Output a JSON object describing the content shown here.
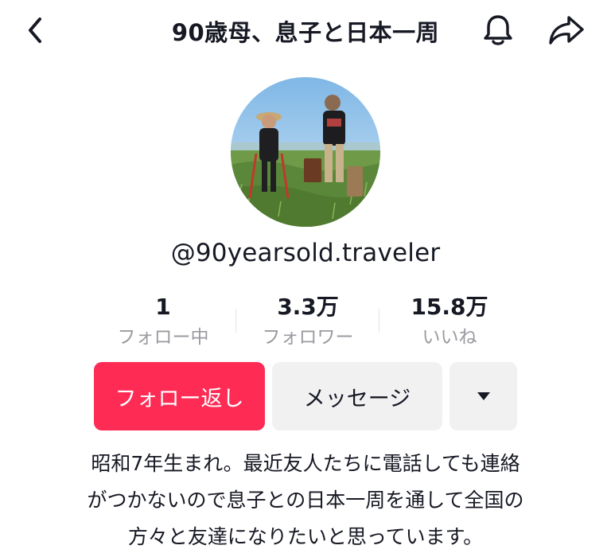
{
  "header": {
    "title": "90歳母、息子と日本一周"
  },
  "profile": {
    "username": "@90yearsold.traveler"
  },
  "stats": [
    {
      "value": "1",
      "label": "フォロー中"
    },
    {
      "value": "3.3万",
      "label": "フォロワー"
    },
    {
      "value": "15.8万",
      "label": "いいね"
    }
  ],
  "actions": {
    "follow_back": "フォロー返し",
    "message": "メッセージ"
  },
  "bio": {
    "lines": [
      "昭和7年生まれ。最近友人たちに電話しても連絡",
      "がつかないので息子との日本一周を通して全国の",
      "方々と友達になりたいと思っています。"
    ]
  },
  "colors": {
    "accent": "#fe2c55",
    "secondary_button": "#f1f1f2",
    "muted_text": "#9a9ba0",
    "primary_text": "#161823"
  },
  "icons": {
    "back": "chevron-left-icon",
    "bell": "bell-icon",
    "share": "share-arrow-icon",
    "more": "caret-down-icon"
  }
}
